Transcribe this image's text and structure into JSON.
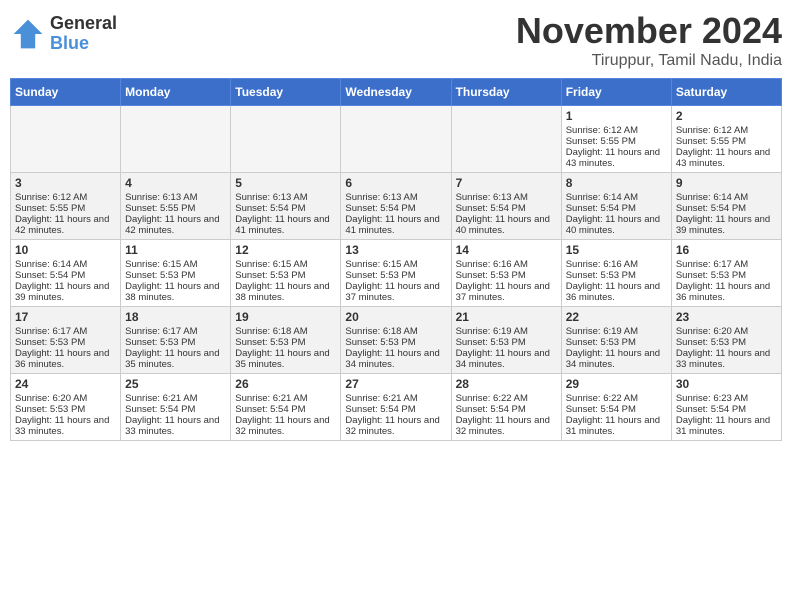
{
  "logo": {
    "general": "General",
    "blue": "Blue"
  },
  "title": "November 2024",
  "location": "Tiruppur, Tamil Nadu, India",
  "days_of_week": [
    "Sunday",
    "Monday",
    "Tuesday",
    "Wednesday",
    "Thursday",
    "Friday",
    "Saturday"
  ],
  "weeks": [
    {
      "shaded": false,
      "days": [
        {
          "date": "",
          "empty": true
        },
        {
          "date": "",
          "empty": true
        },
        {
          "date": "",
          "empty": true
        },
        {
          "date": "",
          "empty": true
        },
        {
          "date": "",
          "empty": true
        },
        {
          "date": "1",
          "sunrise": "Sunrise: 6:12 AM",
          "sunset": "Sunset: 5:55 PM",
          "daylight": "Daylight: 11 hours and 43 minutes."
        },
        {
          "date": "2",
          "sunrise": "Sunrise: 6:12 AM",
          "sunset": "Sunset: 5:55 PM",
          "daylight": "Daylight: 11 hours and 43 minutes."
        }
      ]
    },
    {
      "shaded": true,
      "days": [
        {
          "date": "3",
          "sunrise": "Sunrise: 6:12 AM",
          "sunset": "Sunset: 5:55 PM",
          "daylight": "Daylight: 11 hours and 42 minutes."
        },
        {
          "date": "4",
          "sunrise": "Sunrise: 6:13 AM",
          "sunset": "Sunset: 5:55 PM",
          "daylight": "Daylight: 11 hours and 42 minutes."
        },
        {
          "date": "5",
          "sunrise": "Sunrise: 6:13 AM",
          "sunset": "Sunset: 5:54 PM",
          "daylight": "Daylight: 11 hours and 41 minutes."
        },
        {
          "date": "6",
          "sunrise": "Sunrise: 6:13 AM",
          "sunset": "Sunset: 5:54 PM",
          "daylight": "Daylight: 11 hours and 41 minutes."
        },
        {
          "date": "7",
          "sunrise": "Sunrise: 6:13 AM",
          "sunset": "Sunset: 5:54 PM",
          "daylight": "Daylight: 11 hours and 40 minutes."
        },
        {
          "date": "8",
          "sunrise": "Sunrise: 6:14 AM",
          "sunset": "Sunset: 5:54 PM",
          "daylight": "Daylight: 11 hours and 40 minutes."
        },
        {
          "date": "9",
          "sunrise": "Sunrise: 6:14 AM",
          "sunset": "Sunset: 5:54 PM",
          "daylight": "Daylight: 11 hours and 39 minutes."
        }
      ]
    },
    {
      "shaded": false,
      "days": [
        {
          "date": "10",
          "sunrise": "Sunrise: 6:14 AM",
          "sunset": "Sunset: 5:54 PM",
          "daylight": "Daylight: 11 hours and 39 minutes."
        },
        {
          "date": "11",
          "sunrise": "Sunrise: 6:15 AM",
          "sunset": "Sunset: 5:53 PM",
          "daylight": "Daylight: 11 hours and 38 minutes."
        },
        {
          "date": "12",
          "sunrise": "Sunrise: 6:15 AM",
          "sunset": "Sunset: 5:53 PM",
          "daylight": "Daylight: 11 hours and 38 minutes."
        },
        {
          "date": "13",
          "sunrise": "Sunrise: 6:15 AM",
          "sunset": "Sunset: 5:53 PM",
          "daylight": "Daylight: 11 hours and 37 minutes."
        },
        {
          "date": "14",
          "sunrise": "Sunrise: 6:16 AM",
          "sunset": "Sunset: 5:53 PM",
          "daylight": "Daylight: 11 hours and 37 minutes."
        },
        {
          "date": "15",
          "sunrise": "Sunrise: 6:16 AM",
          "sunset": "Sunset: 5:53 PM",
          "daylight": "Daylight: 11 hours and 36 minutes."
        },
        {
          "date": "16",
          "sunrise": "Sunrise: 6:17 AM",
          "sunset": "Sunset: 5:53 PM",
          "daylight": "Daylight: 11 hours and 36 minutes."
        }
      ]
    },
    {
      "shaded": true,
      "days": [
        {
          "date": "17",
          "sunrise": "Sunrise: 6:17 AM",
          "sunset": "Sunset: 5:53 PM",
          "daylight": "Daylight: 11 hours and 36 minutes."
        },
        {
          "date": "18",
          "sunrise": "Sunrise: 6:17 AM",
          "sunset": "Sunset: 5:53 PM",
          "daylight": "Daylight: 11 hours and 35 minutes."
        },
        {
          "date": "19",
          "sunrise": "Sunrise: 6:18 AM",
          "sunset": "Sunset: 5:53 PM",
          "daylight": "Daylight: 11 hours and 35 minutes."
        },
        {
          "date": "20",
          "sunrise": "Sunrise: 6:18 AM",
          "sunset": "Sunset: 5:53 PM",
          "daylight": "Daylight: 11 hours and 34 minutes."
        },
        {
          "date": "21",
          "sunrise": "Sunrise: 6:19 AM",
          "sunset": "Sunset: 5:53 PM",
          "daylight": "Daylight: 11 hours and 34 minutes."
        },
        {
          "date": "22",
          "sunrise": "Sunrise: 6:19 AM",
          "sunset": "Sunset: 5:53 PM",
          "daylight": "Daylight: 11 hours and 34 minutes."
        },
        {
          "date": "23",
          "sunrise": "Sunrise: 6:20 AM",
          "sunset": "Sunset: 5:53 PM",
          "daylight": "Daylight: 11 hours and 33 minutes."
        }
      ]
    },
    {
      "shaded": false,
      "days": [
        {
          "date": "24",
          "sunrise": "Sunrise: 6:20 AM",
          "sunset": "Sunset: 5:53 PM",
          "daylight": "Daylight: 11 hours and 33 minutes."
        },
        {
          "date": "25",
          "sunrise": "Sunrise: 6:21 AM",
          "sunset": "Sunset: 5:54 PM",
          "daylight": "Daylight: 11 hours and 33 minutes."
        },
        {
          "date": "26",
          "sunrise": "Sunrise: 6:21 AM",
          "sunset": "Sunset: 5:54 PM",
          "daylight": "Daylight: 11 hours and 32 minutes."
        },
        {
          "date": "27",
          "sunrise": "Sunrise: 6:21 AM",
          "sunset": "Sunset: 5:54 PM",
          "daylight": "Daylight: 11 hours and 32 minutes."
        },
        {
          "date": "28",
          "sunrise": "Sunrise: 6:22 AM",
          "sunset": "Sunset: 5:54 PM",
          "daylight": "Daylight: 11 hours and 32 minutes."
        },
        {
          "date": "29",
          "sunrise": "Sunrise: 6:22 AM",
          "sunset": "Sunset: 5:54 PM",
          "daylight": "Daylight: 11 hours and 31 minutes."
        },
        {
          "date": "30",
          "sunrise": "Sunrise: 6:23 AM",
          "sunset": "Sunset: 5:54 PM",
          "daylight": "Daylight: 11 hours and 31 minutes."
        }
      ]
    }
  ]
}
